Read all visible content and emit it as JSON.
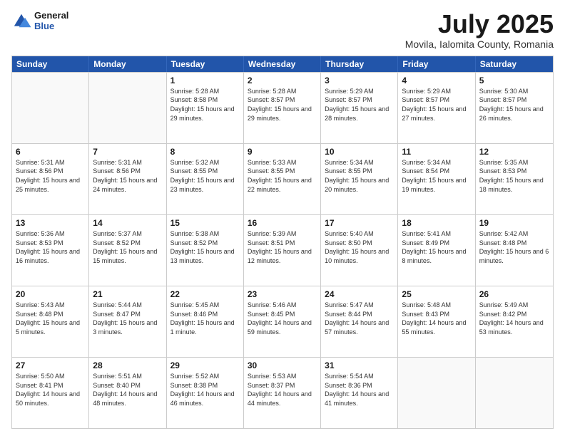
{
  "logo": {
    "line1": "General",
    "line2": "Blue"
  },
  "title": "July 2025",
  "location": "Movila, Ialomita County, Romania",
  "days_of_week": [
    "Sunday",
    "Monday",
    "Tuesday",
    "Wednesday",
    "Thursday",
    "Friday",
    "Saturday"
  ],
  "weeks": [
    [
      {
        "day": "",
        "content": ""
      },
      {
        "day": "",
        "content": ""
      },
      {
        "day": "1",
        "content": "Sunrise: 5:28 AM\nSunset: 8:58 PM\nDaylight: 15 hours and 29 minutes."
      },
      {
        "day": "2",
        "content": "Sunrise: 5:28 AM\nSunset: 8:57 PM\nDaylight: 15 hours and 29 minutes."
      },
      {
        "day": "3",
        "content": "Sunrise: 5:29 AM\nSunset: 8:57 PM\nDaylight: 15 hours and 28 minutes."
      },
      {
        "day": "4",
        "content": "Sunrise: 5:29 AM\nSunset: 8:57 PM\nDaylight: 15 hours and 27 minutes."
      },
      {
        "day": "5",
        "content": "Sunrise: 5:30 AM\nSunset: 8:57 PM\nDaylight: 15 hours and 26 minutes."
      }
    ],
    [
      {
        "day": "6",
        "content": "Sunrise: 5:31 AM\nSunset: 8:56 PM\nDaylight: 15 hours and 25 minutes."
      },
      {
        "day": "7",
        "content": "Sunrise: 5:31 AM\nSunset: 8:56 PM\nDaylight: 15 hours and 24 minutes."
      },
      {
        "day": "8",
        "content": "Sunrise: 5:32 AM\nSunset: 8:55 PM\nDaylight: 15 hours and 23 minutes."
      },
      {
        "day": "9",
        "content": "Sunrise: 5:33 AM\nSunset: 8:55 PM\nDaylight: 15 hours and 22 minutes."
      },
      {
        "day": "10",
        "content": "Sunrise: 5:34 AM\nSunset: 8:55 PM\nDaylight: 15 hours and 20 minutes."
      },
      {
        "day": "11",
        "content": "Sunrise: 5:34 AM\nSunset: 8:54 PM\nDaylight: 15 hours and 19 minutes."
      },
      {
        "day": "12",
        "content": "Sunrise: 5:35 AM\nSunset: 8:53 PM\nDaylight: 15 hours and 18 minutes."
      }
    ],
    [
      {
        "day": "13",
        "content": "Sunrise: 5:36 AM\nSunset: 8:53 PM\nDaylight: 15 hours and 16 minutes."
      },
      {
        "day": "14",
        "content": "Sunrise: 5:37 AM\nSunset: 8:52 PM\nDaylight: 15 hours and 15 minutes."
      },
      {
        "day": "15",
        "content": "Sunrise: 5:38 AM\nSunset: 8:52 PM\nDaylight: 15 hours and 13 minutes."
      },
      {
        "day": "16",
        "content": "Sunrise: 5:39 AM\nSunset: 8:51 PM\nDaylight: 15 hours and 12 minutes."
      },
      {
        "day": "17",
        "content": "Sunrise: 5:40 AM\nSunset: 8:50 PM\nDaylight: 15 hours and 10 minutes."
      },
      {
        "day": "18",
        "content": "Sunrise: 5:41 AM\nSunset: 8:49 PM\nDaylight: 15 hours and 8 minutes."
      },
      {
        "day": "19",
        "content": "Sunrise: 5:42 AM\nSunset: 8:48 PM\nDaylight: 15 hours and 6 minutes."
      }
    ],
    [
      {
        "day": "20",
        "content": "Sunrise: 5:43 AM\nSunset: 8:48 PM\nDaylight: 15 hours and 5 minutes."
      },
      {
        "day": "21",
        "content": "Sunrise: 5:44 AM\nSunset: 8:47 PM\nDaylight: 15 hours and 3 minutes."
      },
      {
        "day": "22",
        "content": "Sunrise: 5:45 AM\nSunset: 8:46 PM\nDaylight: 15 hours and 1 minute."
      },
      {
        "day": "23",
        "content": "Sunrise: 5:46 AM\nSunset: 8:45 PM\nDaylight: 14 hours and 59 minutes."
      },
      {
        "day": "24",
        "content": "Sunrise: 5:47 AM\nSunset: 8:44 PM\nDaylight: 14 hours and 57 minutes."
      },
      {
        "day": "25",
        "content": "Sunrise: 5:48 AM\nSunset: 8:43 PM\nDaylight: 14 hours and 55 minutes."
      },
      {
        "day": "26",
        "content": "Sunrise: 5:49 AM\nSunset: 8:42 PM\nDaylight: 14 hours and 53 minutes."
      }
    ],
    [
      {
        "day": "27",
        "content": "Sunrise: 5:50 AM\nSunset: 8:41 PM\nDaylight: 14 hours and 50 minutes."
      },
      {
        "day": "28",
        "content": "Sunrise: 5:51 AM\nSunset: 8:40 PM\nDaylight: 14 hours and 48 minutes."
      },
      {
        "day": "29",
        "content": "Sunrise: 5:52 AM\nSunset: 8:38 PM\nDaylight: 14 hours and 46 minutes."
      },
      {
        "day": "30",
        "content": "Sunrise: 5:53 AM\nSunset: 8:37 PM\nDaylight: 14 hours and 44 minutes."
      },
      {
        "day": "31",
        "content": "Sunrise: 5:54 AM\nSunset: 8:36 PM\nDaylight: 14 hours and 41 minutes."
      },
      {
        "day": "",
        "content": ""
      },
      {
        "day": "",
        "content": ""
      }
    ]
  ]
}
